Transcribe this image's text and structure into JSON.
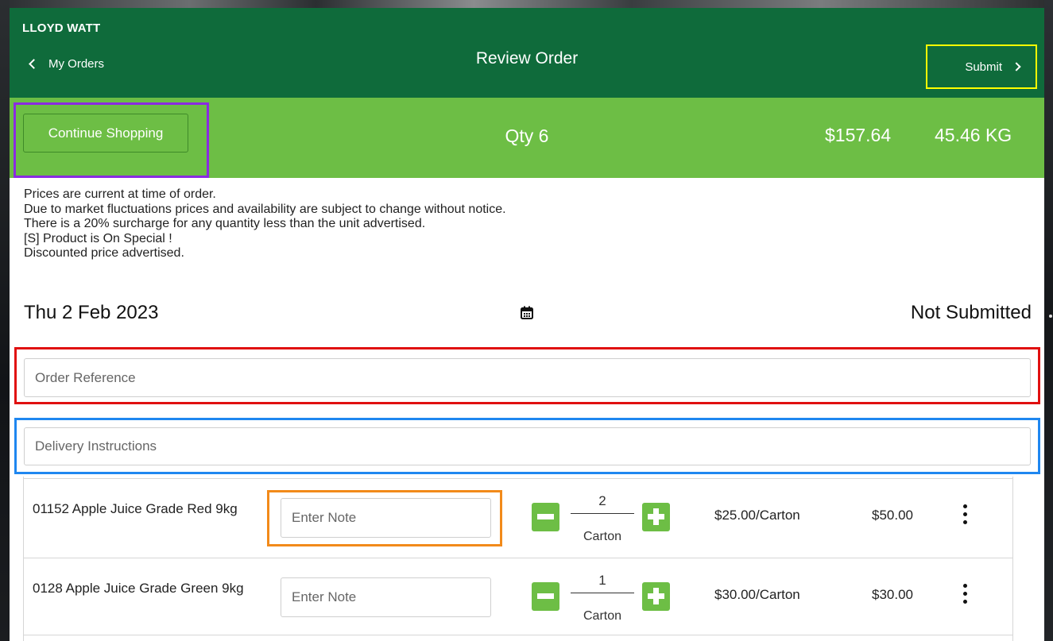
{
  "header": {
    "user_name": "LLOYD WATT",
    "back_label": "My Orders",
    "title": "Review Order",
    "submit_label": "Submit"
  },
  "summary": {
    "continue_label": "Continue Shopping",
    "qty": "Qty 6",
    "total_price": "$157.64",
    "total_weight": "45.46 KG"
  },
  "notices": [
    "Prices are current at time of order.",
    "Due to market fluctuations prices and availability are subject to change without notice.",
    "There is a 20% surcharge for any quantity less than the unit advertised.",
    "[S] Product is On Special !",
    "Discounted price advertised."
  ],
  "order": {
    "date": "Thu 2 Feb 2023",
    "status": "Not Submitted",
    "reference_placeholder": "Order Reference",
    "delivery_placeholder": "Delivery Instructions"
  },
  "products": [
    {
      "name": "01152 Apple Juice Grade Red 9kg",
      "note_placeholder": "Enter Note",
      "quantity": "2",
      "unit": "Carton",
      "unit_price": "$25.00/Carton",
      "line_total": "$50.00"
    },
    {
      "name": "0128 Apple Juice Grade Green 9kg",
      "note_placeholder": "Enter Note",
      "quantity": "1",
      "unit": "Carton",
      "unit_price": "$30.00/Carton",
      "line_total": "$30.00"
    }
  ],
  "icons": {
    "back": "chevron-left-icon",
    "submit": "chevron-right-icon",
    "calendar": "calendar-icon",
    "decrease": "minus-icon",
    "increase": "plus-icon",
    "more": "more-vertical-icon"
  },
  "colors": {
    "header_bg": "#0f6b3b",
    "summary_bg": "#6dbe45",
    "accent_green": "#6dbe45",
    "submit_highlight": "#ffff00",
    "continue_highlight": "#8a2be2",
    "reference_highlight": "#e01010",
    "delivery_highlight": "#1f87f0",
    "note_highlight": "#f28a1a"
  }
}
